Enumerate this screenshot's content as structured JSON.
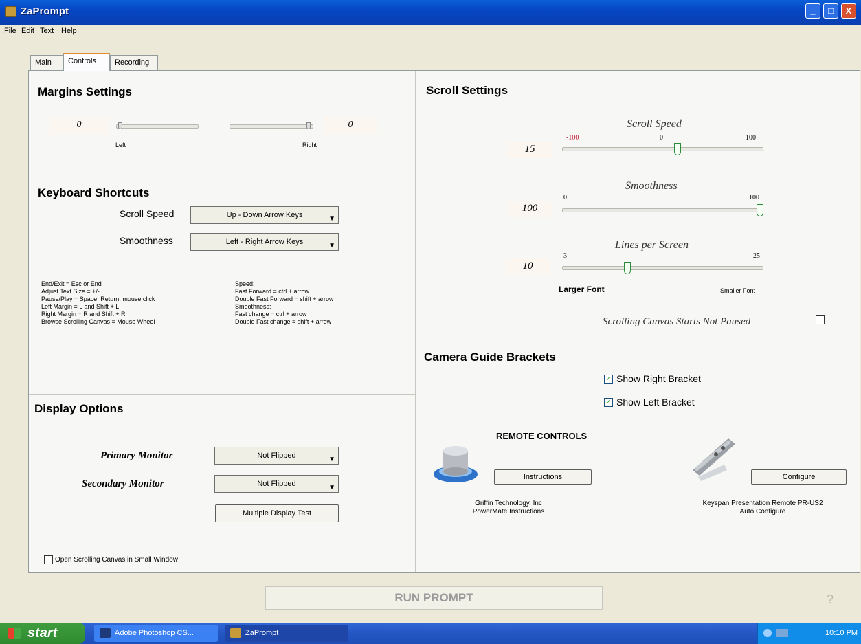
{
  "window": {
    "title": "ZaPrompt",
    "controls": {
      "minimize": "_",
      "maximize": "□",
      "close": "X"
    }
  },
  "menu": [
    "File",
    "Edit",
    "Text",
    "Help"
  ],
  "tabs": [
    "Main",
    "Controls",
    "Recording"
  ],
  "active_tab": "Controls",
  "margins": {
    "title": "Margins Settings",
    "left_value": "0",
    "right_value": "0",
    "left_label": "Left",
    "right_label": "Right",
    "left_level": 0,
    "right_level": 0
  },
  "keyboard": {
    "title": "Keyboard Shortcuts",
    "scroll_speed_label": "Scroll Speed",
    "scroll_speed_value": "Up - Down Arrow Keys",
    "smoothness_label": "Smoothness",
    "smoothness_value": "Left - Right Arrow Keys",
    "help_left": [
      "End/Exit = Esc or End",
      "Adjust Text Size = +/-",
      "Pause/Play = Space, Return, mouse click",
      "Left Margin = L and Shift + L",
      "Right Margin = R and Shift + R",
      "Browse Scrolling Canvas = Mouse Wheel"
    ],
    "help_right": [
      "Speed:",
      "Fast Forward = ctrl + arrow",
      "Double Fast Forward = shift + arrow",
      "Smoothness:",
      "Fast change = ctrl + arrow",
      "Double Fast change = shift + arrow"
    ]
  },
  "display": {
    "title": "Display Options",
    "primary_label": "Primary Monitor",
    "primary_value": "Not Flipped",
    "secondary_label": "Secondary Monitor",
    "secondary_value": "Not Flipped",
    "test_button": "Multiple Display Test",
    "small_window_label": "Open Scrolling Canvas in Small Window",
    "small_window_checked": false
  },
  "scroll": {
    "title": "Scroll Settings",
    "speed": {
      "label": "Scroll Speed",
      "value": "15",
      "min": "-100",
      "mid": "0",
      "max": "100",
      "level": 15
    },
    "smoothness": {
      "label": "Smoothness",
      "value": "100",
      "min": "0",
      "max": "100",
      "level": 100
    },
    "lines": {
      "label": "Lines per Screen",
      "value": "10",
      "min": "3",
      "max": "25",
      "level": 10,
      "left_caption": "Larger Font",
      "right_caption": "Smaller Font"
    },
    "not_paused_label": "Scrolling Canvas Starts Not Paused",
    "not_paused_checked": false
  },
  "brackets": {
    "title": "Camera Guide Brackets",
    "right_label": "Show Right Bracket",
    "right_checked": true,
    "left_label": "Show Left Bracket",
    "left_checked": true
  },
  "remote": {
    "title": "REMOTE CONTROLS",
    "griffin_button": "Instructions",
    "griffin_caption_1": "Griffin Technology, Inc",
    "griffin_caption_2": "PowerMate Instructions",
    "keyspan_button": "Configure",
    "keyspan_caption_1": "Keyspan Presentation Remote PR-US2",
    "keyspan_caption_2": "Auto Configure"
  },
  "run_button": "RUN PROMPT",
  "help_mark": "?",
  "taskbar": {
    "start": "start",
    "tasks": [
      "Adobe Photoshop CS...",
      "ZaPrompt"
    ],
    "clock": "10:10 PM"
  },
  "colors": {
    "titlebar": "#0a5fd9",
    "tick_red": "#c0243c",
    "taskbar": "#2456c4",
    "start": "#3e9d3e"
  }
}
